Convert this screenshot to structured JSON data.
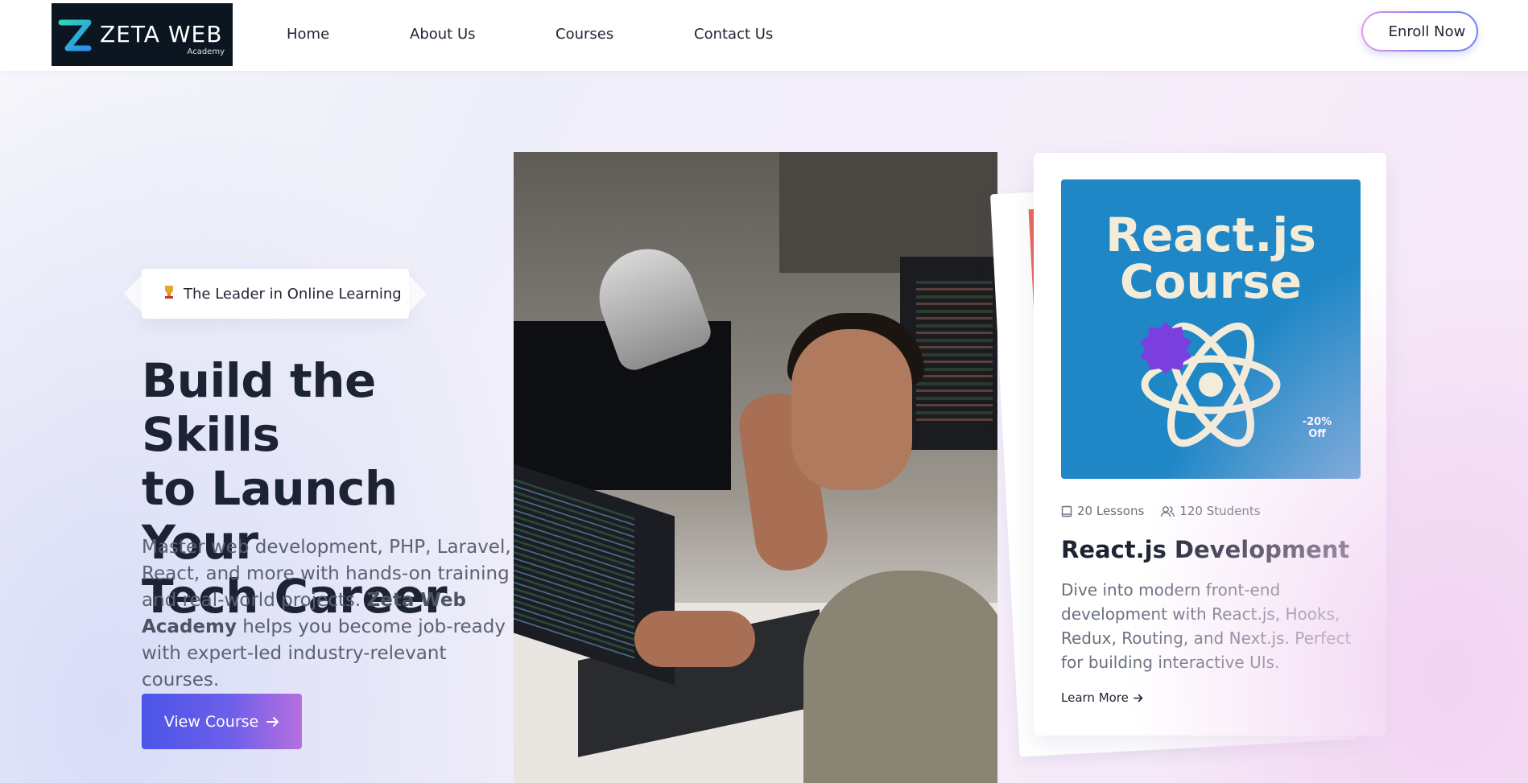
{
  "header": {
    "logo_text": "ZETA WEB",
    "logo_sub": "Academy",
    "nav": [
      "Home",
      "About Us",
      "Courses",
      "Contact Us"
    ],
    "enroll_label": "Enroll Now"
  },
  "hero": {
    "badge_icon": "trophy-icon",
    "badge_text": "The Leader in Online Learning",
    "headline_1": "Build the Skills",
    "headline_2": "to Launch Your",
    "headline_3": "Tech Career",
    "desc_part1": "Master web development, PHP, Laravel, React, and more with hands-on training and real-world projects.",
    "desc_brand": "Zeta Web Academy",
    "desc_part2": "helps you become job-ready with expert-led industry-relevant courses.",
    "cta_label": "View Course"
  },
  "course_card": {
    "thumb_line1": "React.js",
    "thumb_line2": "Course",
    "discount_line1": "-20%",
    "discount_line2": "Off",
    "lessons": "20 Lessons",
    "students": "120 Students",
    "title": "React.js Development",
    "description": "Dive into modern front-end development with React.js, Hooks, Redux, Routing, and Next.js. Perfect for building interactive UIs.",
    "link_label": "Learn More"
  },
  "colors": {
    "accent_start": "#4a55e8",
    "accent_end": "#b66fe0",
    "thumb_bg": "#1f87c6",
    "badge_purple": "#7b3fe0"
  }
}
